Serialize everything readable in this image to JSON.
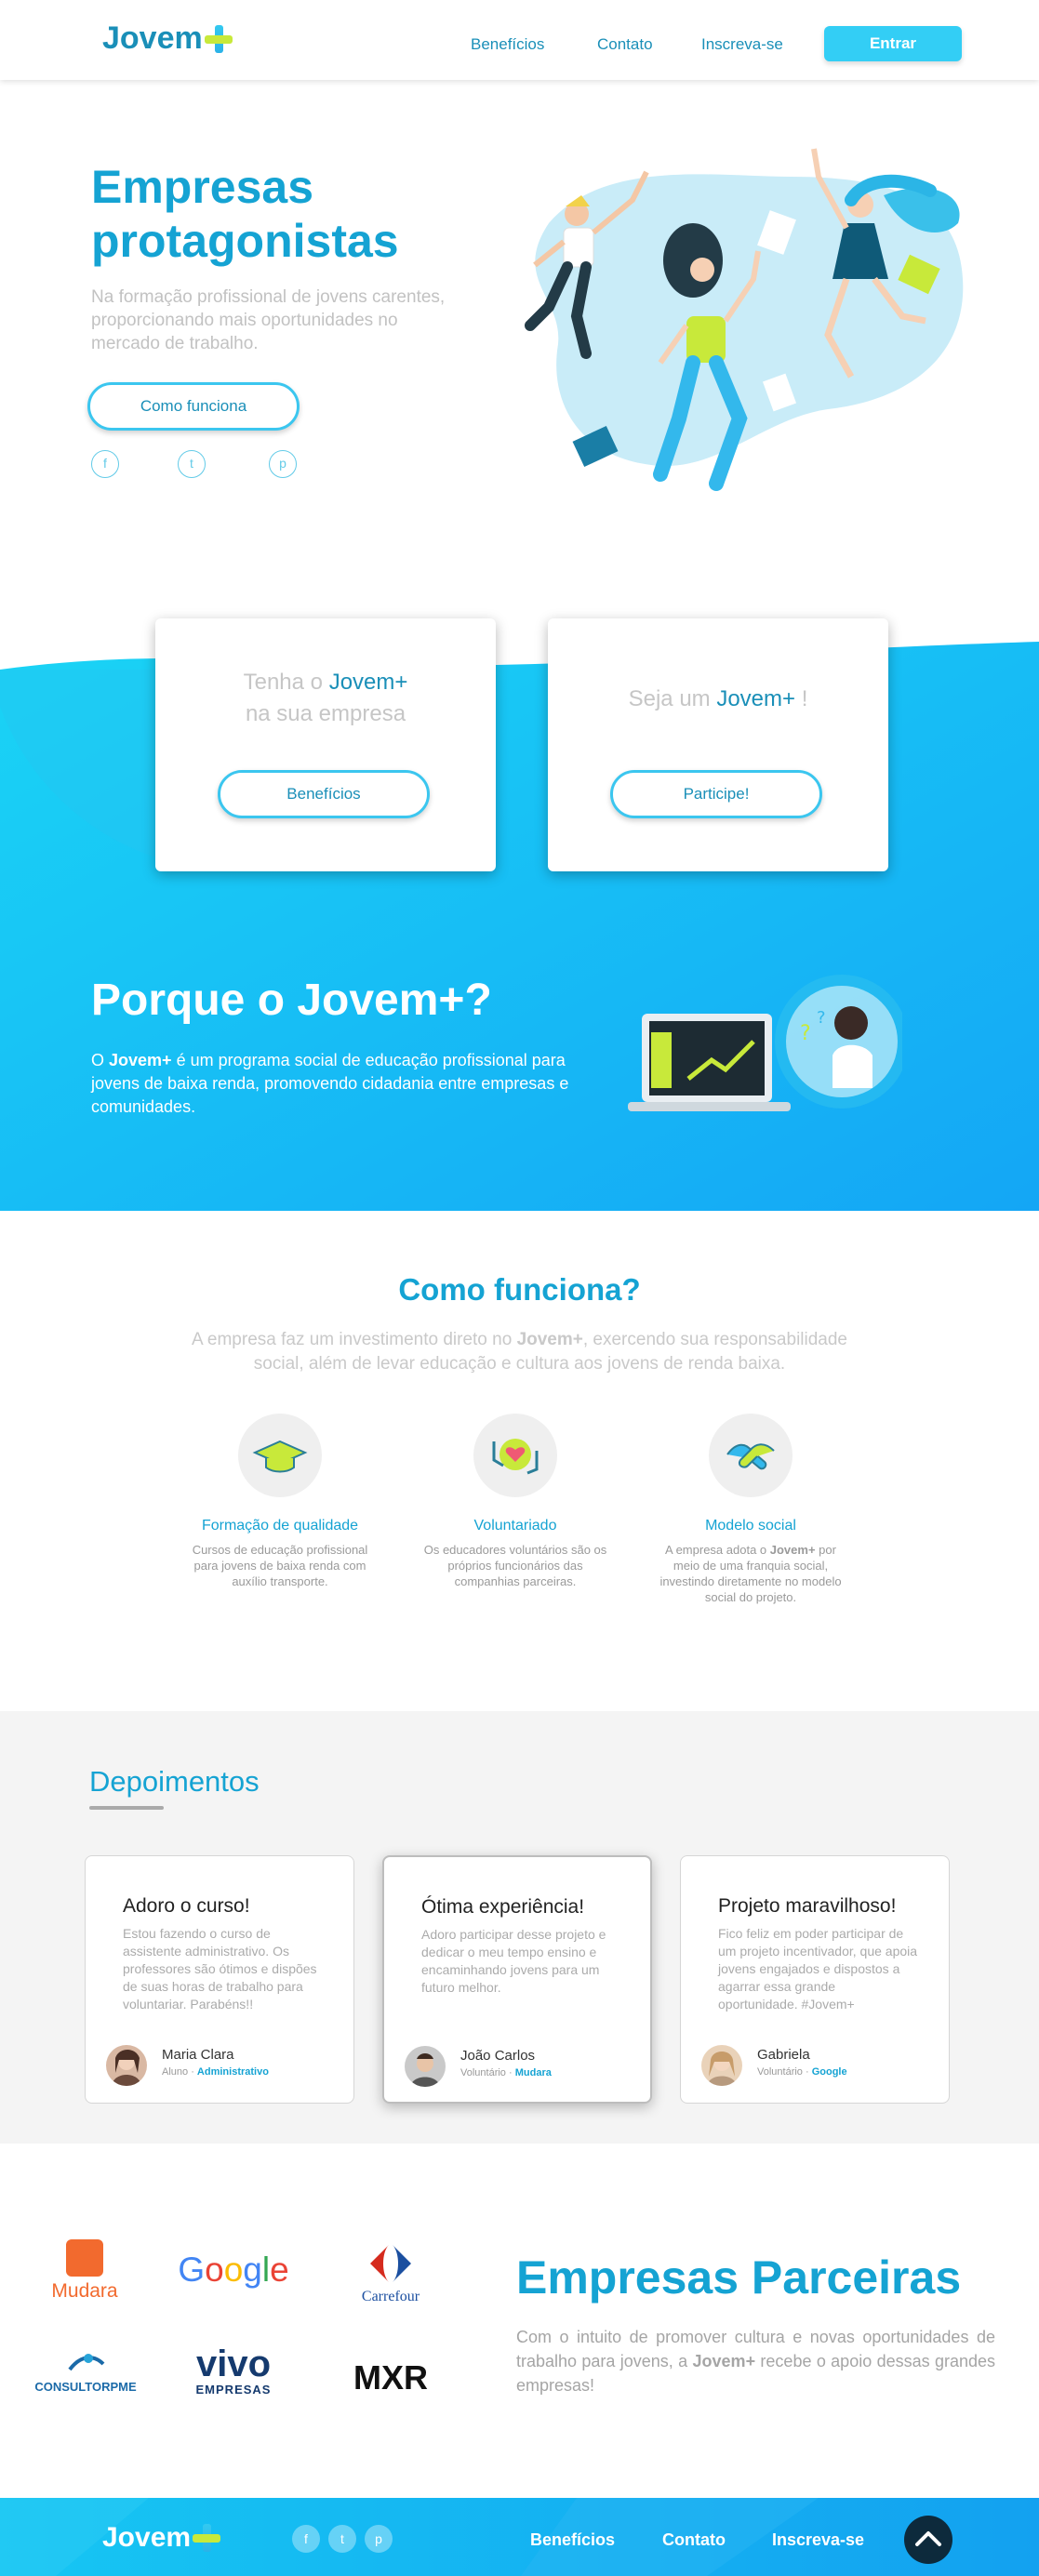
{
  "header": {
    "logo": "Jovem",
    "nav": [
      "Benefícios",
      "Contato",
      "Inscreva-se"
    ],
    "login_label": "Entrar"
  },
  "hero": {
    "title_line1": "Empresas",
    "title_line2": "protagonistas",
    "subtitle": "Na formação profissional de jovens carentes, proporcionando mais oportunidades no mercado de trabalho.",
    "cta_label": "Como funciona",
    "social": [
      "f",
      "t",
      "p"
    ]
  },
  "cards": [
    {
      "pre": "Tenha o ",
      "highlight": "Jovem+",
      "post": "na sua empresa",
      "button": "Benefícios"
    },
    {
      "pre": "Seja um ",
      "highlight": "Jovem+",
      "post": " !",
      "button": "Participe!"
    }
  ],
  "why": {
    "title": "Porque o Jovem+?",
    "text_pre": "O ",
    "text_bold": "Jovem+",
    "text_post": " é um programa social de educação profissional para jovens de baixa renda, promovendo cidadania entre empresas e comunidades."
  },
  "how": {
    "title": "Como funciona?",
    "sub_pre": "A empresa faz um investimento direto no ",
    "sub_bold": "Jovem+",
    "sub_post": ", exercendo sua responsabilidade social, além de levar educação e cultura aos jovens de renda baixa.",
    "features": [
      {
        "title": "Formação de qualidade",
        "desc": "Cursos de educação profissional para jovens de baixa renda com auxílio transporte.",
        "icon": "graduation-cap-icon"
      },
      {
        "title": "Voluntariado",
        "desc": "Os educadores voluntários são os próprios funcionários das companhias parceiras.",
        "icon": "heart-hands-icon"
      },
      {
        "title": "Modelo social",
        "desc_pre": "A empresa adota o ",
        "desc_bold": "Jovem+",
        "desc_post": " por meio de uma franquia social, investindo diretamente no modelo social do projeto.",
        "icon": "handshake-icon"
      }
    ]
  },
  "testimonials": {
    "title": "Depoimentos",
    "items": [
      {
        "title": "Adoro o curso!",
        "body": "Estou fazendo o curso de assistente administrativo. Os professores são ótimos e dispões de suas horas de trabalho para voluntariar. Parabéns!!",
        "name": "Maria Clara",
        "role": "Aluno",
        "company": "Administrativo"
      },
      {
        "title": "Ótima experiência!",
        "body": "Adoro participar desse projeto e dedicar o meu tempo ensino e encaminhando jovens para um futuro melhor.",
        "name": "João Carlos",
        "role": "Voluntário",
        "company": "Mudara"
      },
      {
        "title": "Projeto maravilhoso!",
        "body": "Fico feliz em poder participar de um projeto incentivador, que apoia jovens engajados e dispostos a agarrar essa grande oportunidade. #Jovem+",
        "name": "Gabriela",
        "role": "Voluntário",
        "company": "Google"
      }
    ]
  },
  "partners": {
    "title": "Empresas Parceiras",
    "text_pre": "Com o intuito de promover cultura e novas oportunidades de trabalho para jovens, a ",
    "text_bold": "Jovem+",
    "text_post": " recebe o apoio dessas grandes empresas!",
    "logos": [
      "Mudara",
      "Google",
      "Carrefour",
      "CONSULTORPME",
      "vivo",
      "EMPRESAS",
      "MXR"
    ]
  },
  "footer": {
    "logo": "Jovem",
    "social": [
      "f",
      "t",
      "p"
    ],
    "nav": [
      "Benefícios",
      "Contato",
      "Inscreva-se"
    ]
  },
  "colors": {
    "primary": "#15a3d3",
    "accent": "#33cef5",
    "lime": "#c8e93a",
    "dark": "#0d2a3c"
  }
}
